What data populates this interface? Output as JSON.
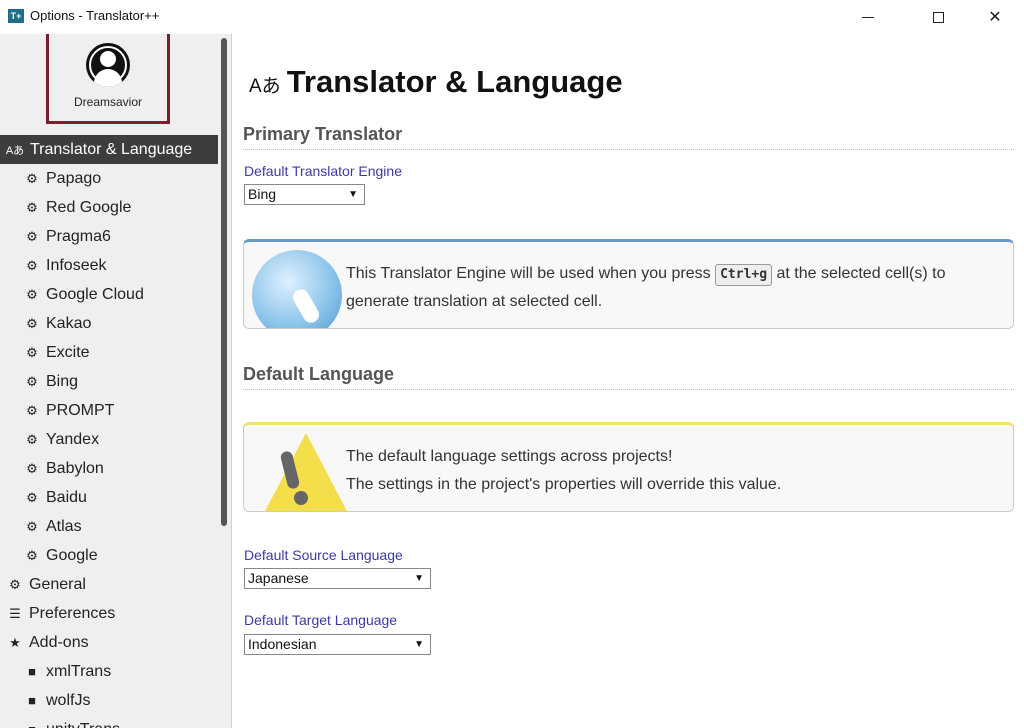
{
  "window": {
    "title": "Options - Translator++",
    "app_icon_text": "T+"
  },
  "profile": {
    "name": "Dreamsavior"
  },
  "sidebar": {
    "items": [
      {
        "label": "Translator & Language",
        "icon": "translate-icon",
        "glyph": "Aあ",
        "level": "active"
      },
      {
        "label": "Papago",
        "icon": "gears-icon",
        "glyph": "⚙",
        "level": "sub"
      },
      {
        "label": "Red Google",
        "icon": "gears-icon",
        "glyph": "⚙",
        "level": "sub"
      },
      {
        "label": "Pragma6",
        "icon": "gears-icon",
        "glyph": "⚙",
        "level": "sub"
      },
      {
        "label": "Infoseek",
        "icon": "gears-icon",
        "glyph": "⚙",
        "level": "sub"
      },
      {
        "label": "Google Cloud",
        "icon": "gears-icon",
        "glyph": "⚙",
        "level": "sub"
      },
      {
        "label": "Kakao",
        "icon": "gears-icon",
        "glyph": "⚙",
        "level": "sub"
      },
      {
        "label": "Excite",
        "icon": "gears-icon",
        "glyph": "⚙",
        "level": "sub"
      },
      {
        "label": "Bing",
        "icon": "gears-icon",
        "glyph": "⚙",
        "level": "sub"
      },
      {
        "label": "PROMPT",
        "icon": "gears-icon",
        "glyph": "⚙",
        "level": "sub"
      },
      {
        "label": "Yandex",
        "icon": "gears-icon",
        "glyph": "⚙",
        "level": "sub"
      },
      {
        "label": "Babylon",
        "icon": "gears-icon",
        "glyph": "⚙",
        "level": "sub"
      },
      {
        "label": "Baidu",
        "icon": "gears-icon",
        "glyph": "⚙",
        "level": "sub"
      },
      {
        "label": "Atlas",
        "icon": "gears-icon",
        "glyph": "⚙",
        "level": "sub"
      },
      {
        "label": "Google",
        "icon": "gears-icon",
        "glyph": "⚙",
        "level": "sub"
      },
      {
        "label": "General",
        "icon": "gear-icon",
        "glyph": "⚙",
        "level": "top"
      },
      {
        "label": "Preferences",
        "icon": "preferences-icon",
        "glyph": "☰",
        "level": "top"
      },
      {
        "label": "Add-ons",
        "icon": "star-icon",
        "glyph": "★",
        "level": "top"
      },
      {
        "label": "xmlTrans",
        "icon": "archive-icon",
        "glyph": "■",
        "level": "sub2"
      },
      {
        "label": "wolfJs",
        "icon": "archive-icon",
        "glyph": "■",
        "level": "sub2"
      },
      {
        "label": "unityTrans",
        "icon": "archive-icon",
        "glyph": "■",
        "level": "sub2"
      }
    ]
  },
  "main": {
    "title": "Translator & Language",
    "title_glyph": "Aあ",
    "primary": {
      "heading": "Primary Translator",
      "engine_label": "Default Translator Engine",
      "engine_value": "Bing",
      "info_before": "This Translator Engine will be used when you press",
      "info_key": "Ctrl+g",
      "info_after": "at the selected cell(s) to",
      "info_line2": "generate translation at selected cell."
    },
    "language": {
      "heading": "Default Language",
      "info_line1": "The default language settings across projects!",
      "info_line2": "The settings in the project's properties will override this value.",
      "source_label": "Default Source Language",
      "source_value": "Japanese",
      "target_label": "Default Target Language",
      "target_value": "Indonesian"
    }
  },
  "colors": {
    "active_bg": "#3d3d3d",
    "label_blue": "#3b3b9e",
    "profile_border": "#7a1f2b"
  }
}
